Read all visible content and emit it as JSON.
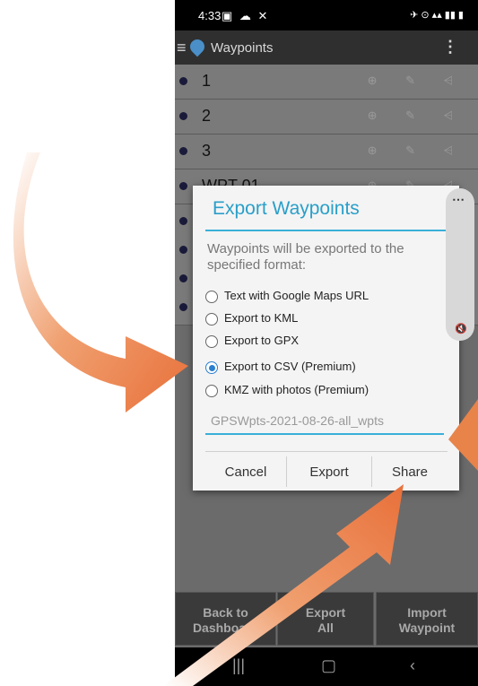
{
  "status_bar": {
    "time": "4:33",
    "left_icons": "▣ ☁ ✕",
    "right_icons": "✈ ⊙ ▴▴ ▮▮ ▮"
  },
  "app_bar": {
    "title": "Waypoints",
    "overflow": "⋮"
  },
  "waypoints": [
    {
      "name": "1"
    },
    {
      "name": "2"
    },
    {
      "name": "3"
    },
    {
      "name": "WPT 01"
    },
    {
      "name": ""
    },
    {
      "name": ""
    },
    {
      "name": ""
    },
    {
      "name": ""
    }
  ],
  "row_actions": "⊕ ✎ ⩤",
  "dialog": {
    "title": "Export Waypoints",
    "message": "Waypoints will be exported to the specified format:",
    "options": [
      {
        "label": "Text with Google Maps URL",
        "selected": false
      },
      {
        "label": "Export to KML",
        "selected": false
      },
      {
        "label": "Export to GPX",
        "selected": false
      },
      {
        "label": "Export to CSV (Premium)",
        "selected": true
      },
      {
        "label": "KMZ with photos (Premium)",
        "selected": false
      }
    ],
    "filename": "GPSWpts-2021-08-26-all_wpts",
    "buttons": {
      "cancel": "Cancel",
      "export": "Export",
      "share": "Share"
    }
  },
  "volume_panel": {
    "more": "⋯",
    "mute": "🔇"
  },
  "bottom_buttons": {
    "back": [
      "Back to",
      "Dashboard"
    ],
    "export_all": [
      "Export",
      "All"
    ],
    "import": [
      "Import",
      "Waypoint"
    ]
  },
  "nav": {
    "recents": "|||",
    "home": "▢",
    "back": "‹"
  },
  "colors": {
    "accent": "#2a9fc9",
    "arrow": "#e8834a"
  }
}
